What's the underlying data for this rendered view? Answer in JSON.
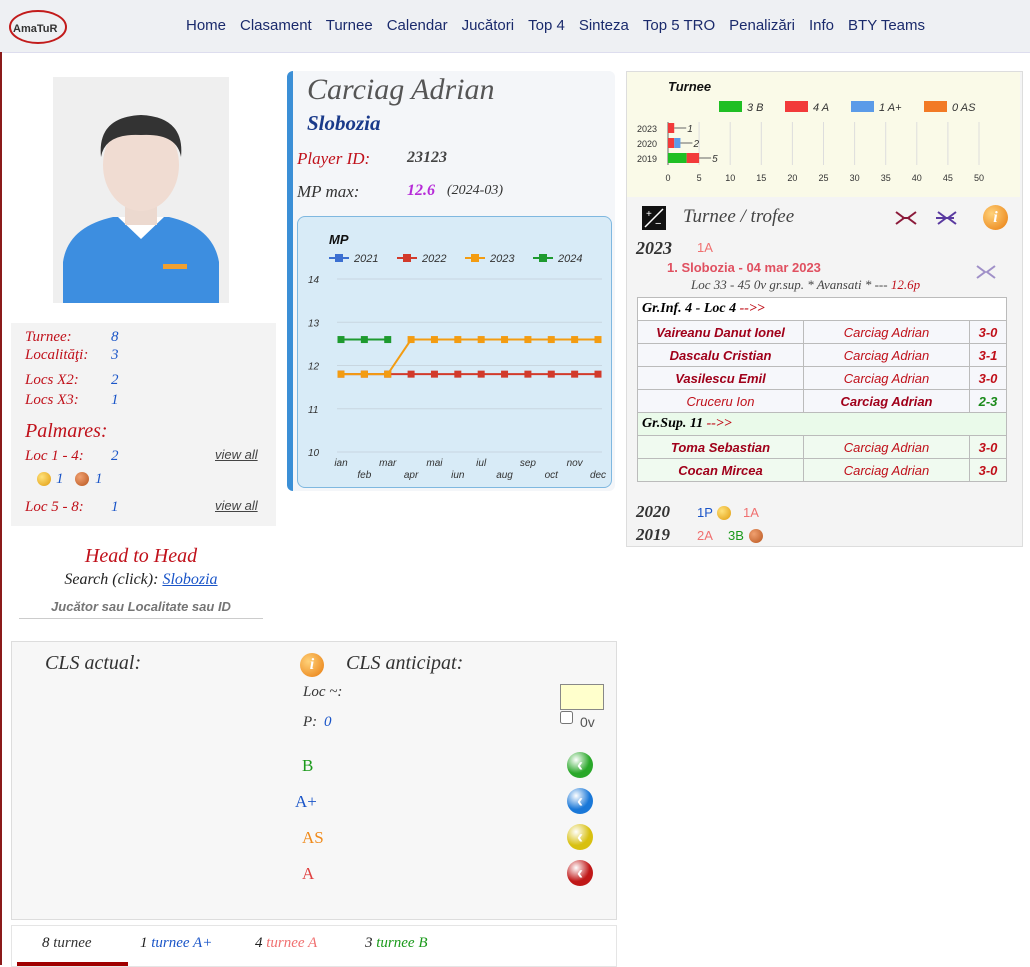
{
  "nav": {
    "logo_text": "AmaTuR",
    "items": [
      "Home",
      "Clasament",
      "Turnee",
      "Calendar",
      "Jucători",
      "Top 4",
      "Sinteza",
      "Top 5 TRO",
      "Penalizări",
      "Info",
      "BTY Teams"
    ]
  },
  "player": {
    "name": "Carciag Adrian",
    "city": "Slobozia",
    "id_label": "Player ID:",
    "id_value": "23123",
    "mpmax_label": "MP max:",
    "mpmax_value": "12.6",
    "mpmax_date": "(2024-03)"
  },
  "stats": {
    "turnee_label": "Turnee:",
    "turnee_value": "8",
    "localitati_label": "Localităţi:",
    "localitati_value": "3",
    "locs_x2_label": "Locs X2:",
    "locs_x2_value": "2",
    "locs_x3_label": "Locs X3:",
    "locs_x3_value": "1",
    "palmares_label": "Palmares:",
    "loc14_label": "Loc 1 - 4:",
    "loc14_value": "2",
    "medal_gold_count": "1",
    "medal_bronze_count": "1",
    "loc58_label": "Loc 5 - 8:",
    "loc58_value": "1",
    "view_all": "view all"
  },
  "h2h": {
    "title": "Head to Head",
    "search_label": "Search (click):",
    "search_link": "Slobozia",
    "placeholder": "Jucător sau Localitate sau ID"
  },
  "chart_data": [
    {
      "type": "line",
      "title": "MP",
      "x": [
        "ian",
        "feb",
        "mar",
        "apr",
        "mai",
        "iun",
        "iul",
        "aug",
        "sep",
        "oct",
        "nov",
        "dec"
      ],
      "ylim": [
        10,
        14
      ],
      "yticks": [
        10,
        11,
        12,
        13,
        14
      ],
      "series": [
        {
          "name": "2021",
          "color": "#3b6fd1",
          "values": [
            null,
            null,
            null,
            null,
            null,
            null,
            null,
            null,
            null,
            null,
            null,
            null
          ]
        },
        {
          "name": "2022",
          "color": "#d23a2b",
          "values": [
            11.8,
            11.8,
            11.8,
            11.8,
            11.8,
            11.8,
            11.8,
            11.8,
            11.8,
            11.8,
            11.8,
            11.8
          ]
        },
        {
          "name": "2023",
          "color": "#f39c12",
          "values": [
            11.8,
            11.8,
            11.8,
            12.6,
            12.6,
            12.6,
            12.6,
            12.6,
            12.6,
            12.6,
            12.6,
            12.6
          ]
        },
        {
          "name": "2024",
          "color": "#1e9a2f",
          "values": [
            12.6,
            12.6,
            12.6,
            null,
            null,
            null,
            null,
            null,
            null,
            null,
            null,
            null
          ]
        }
      ]
    },
    {
      "type": "bar",
      "title": "Turnee",
      "categories": [
        "2023",
        "2020",
        "2019"
      ],
      "series": [
        {
          "name": "3 B",
          "color": "#1fbf24",
          "values": [
            0,
            0,
            3
          ]
        },
        {
          "name": "4 A",
          "color": "#f23a3a",
          "values": [
            1,
            1,
            2
          ]
        },
        {
          "name": "1 A+",
          "color": "#5b9be8",
          "values": [
            0,
            1,
            0
          ]
        },
        {
          "name": "0 AS",
          "color": "#f27a25",
          "values": [
            0,
            0,
            0
          ]
        }
      ],
      "totals": [
        "1",
        "2",
        "5"
      ],
      "xticks": [
        0,
        5,
        10,
        15,
        20,
        25,
        30,
        35,
        40,
        45,
        50
      ],
      "xlim": [
        0,
        50
      ]
    }
  ],
  "trofee": {
    "title": "Turnee / trofee",
    "y2023": "2023",
    "y2023_tag": "1A",
    "event": "1. Slobozia - 04 mar 2023",
    "event_detail": "Loc 33 - 45 0v gr.sup. * Avansati * --- ",
    "event_mp": "12.6p",
    "group_inf": "Gr.Inf. 4 - Loc 4 ",
    "group_sup": "Gr.Sup. 11 ",
    "arrow": "-->>",
    "matches_inf": [
      {
        "p1": "Vaireanu Danut Ionel",
        "p2": "Carciag Adrian",
        "score": "3-0",
        "win": false
      },
      {
        "p1": "Dascalu Cristian",
        "p2": "Carciag Adrian",
        "score": "3-1",
        "win": false
      },
      {
        "p1": "Vasilescu Emil",
        "p2": "Carciag Adrian",
        "score": "3-0",
        "win": false
      },
      {
        "p1": "Cruceru Ion",
        "p2": "Carciag Adrian",
        "score": "2-3",
        "win": true
      }
    ],
    "matches_sup": [
      {
        "p1": "Toma Sebastian",
        "p2": "Carciag Adrian",
        "score": "3-0",
        "win": false
      },
      {
        "p1": "Cocan Mircea",
        "p2": "Carciag Adrian",
        "score": "3-0",
        "win": false
      }
    ],
    "y2020": "2020",
    "y2020_a": "1P",
    "y2020_b": "1A",
    "y2019": "2019",
    "y2019_a": "2A",
    "y2019_b": "3B"
  },
  "cls": {
    "actual": "CLS actual:",
    "anticipat": "CLS anticipat:",
    "loc_label": "Loc ~:",
    "p_label": "P:",
    "p_value": "0",
    "ov_label": "0v",
    "levels": [
      "B",
      "A+",
      "AS",
      "A"
    ],
    "level_colors": [
      "#1a9a1a",
      "#1a55c8",
      "#f08a1a",
      "#e04040"
    ]
  },
  "tabs": [
    {
      "count": "8",
      "label": "turnee",
      "color": "#333"
    },
    {
      "count": "1",
      "label": "turnee A+",
      "color": "#1a55c8"
    },
    {
      "count": "4",
      "label": "turnee A",
      "color": "#f07070"
    },
    {
      "count": "3",
      "label": "turnee B",
      "color": "#1a9a1a"
    }
  ]
}
